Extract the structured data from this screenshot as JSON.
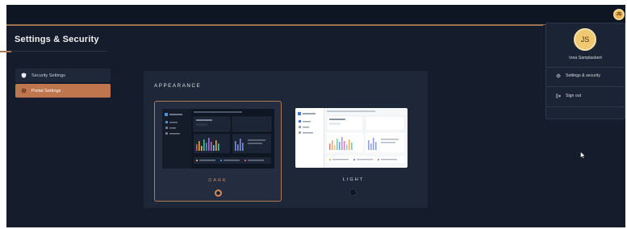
{
  "header": {
    "title": "Settings & Security"
  },
  "user": {
    "initials": "JS",
    "menu_badge": "JS",
    "name": "Inna Samplasbert"
  },
  "sidebar": {
    "items": [
      {
        "label": "Security Settings",
        "icon": "shield-icon",
        "active": false
      },
      {
        "label": "Portal Settings",
        "icon": "gear-icon",
        "active": true
      }
    ]
  },
  "appearance": {
    "title": "APPEARANCE",
    "options": [
      {
        "label": "DARK",
        "selected": true
      },
      {
        "label": "LIGHT",
        "selected": false
      }
    ]
  },
  "dropdown": {
    "items": [
      {
        "label": "Settings & security",
        "icon": "gear-icon"
      },
      {
        "label": "Sign out",
        "icon": "sign-out-icon"
      }
    ]
  },
  "colors": {
    "app_bg": "#151d2c",
    "accent": "#c0764d",
    "panel_bg": "#1e2738",
    "avatar": "#f0c870"
  }
}
